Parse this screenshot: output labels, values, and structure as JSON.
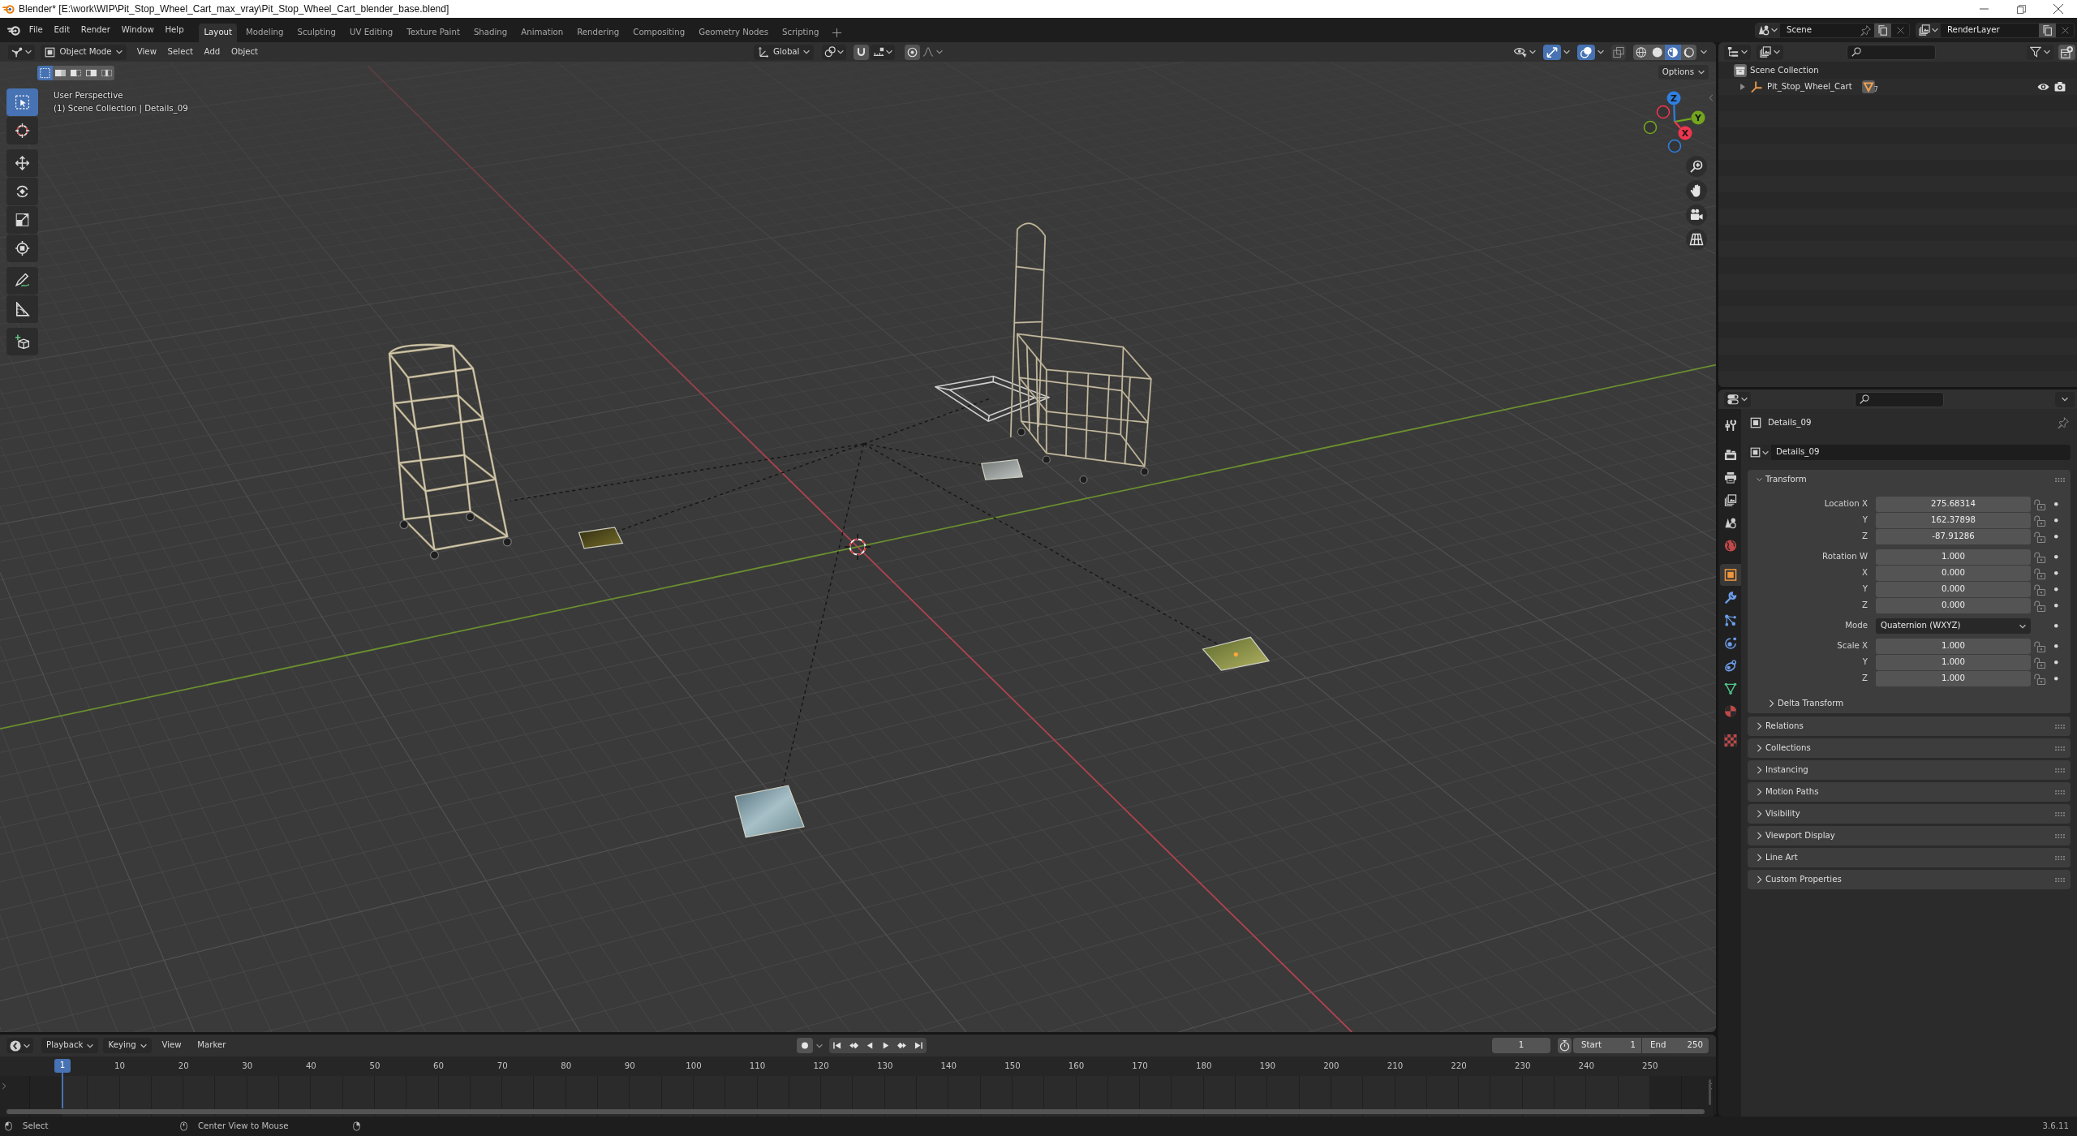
{
  "window": {
    "title": "Blender* [E:\\work\\WIP\\Pit_Stop_Wheel_Cart_max_vray\\Pit_Stop_Wheel_Cart_blender_base.blend]"
  },
  "menu": [
    "File",
    "Edit",
    "Render",
    "Window",
    "Help"
  ],
  "workspaces": [
    {
      "label": "Layout",
      "selected": true
    },
    {
      "label": "Modeling",
      "selected": false
    },
    {
      "label": "Sculpting",
      "selected": false
    },
    {
      "label": "UV Editing",
      "selected": false
    },
    {
      "label": "Texture Paint",
      "selected": false
    },
    {
      "label": "Shading",
      "selected": false
    },
    {
      "label": "Animation",
      "selected": false
    },
    {
      "label": "Rendering",
      "selected": false
    },
    {
      "label": "Compositing",
      "selected": false
    },
    {
      "label": "Geometry Nodes",
      "selected": false
    },
    {
      "label": "Scripting",
      "selected": false
    }
  ],
  "scene": {
    "name": "Scene",
    "view_layer": "RenderLayer"
  },
  "viewport": {
    "mode": "Object Mode",
    "menus": [
      "View",
      "Select",
      "Add",
      "Object"
    ],
    "orientation": "Global",
    "toggles": [
      {
        "kind": "gizmos",
        "on": true
      },
      {
        "kind": "overlays",
        "on": true
      },
      {
        "kind": "xray",
        "on": false
      }
    ],
    "shading": [
      {
        "kind": "wireframe",
        "selected": false
      },
      {
        "kind": "solid",
        "selected": false
      },
      {
        "kind": "material",
        "selected": true
      },
      {
        "kind": "rendered",
        "selected": false
      }
    ],
    "select_modes": [
      {
        "kind": "set",
        "selected": true
      },
      {
        "kind": "extend",
        "selected": false
      },
      {
        "kind": "subtract",
        "selected": false
      },
      {
        "kind": "invert",
        "selected": false
      },
      {
        "kind": "intersect",
        "selected": false
      }
    ],
    "tool_groups": [
      {
        "tools": [
          {
            "kind": "select_box",
            "selected": true
          },
          {
            "kind": "cursor",
            "selected": false
          }
        ]
      },
      {
        "tools": [
          {
            "kind": "move",
            "selected": false
          },
          {
            "kind": "rotate",
            "selected": false
          },
          {
            "kind": "scale",
            "selected": false
          },
          {
            "kind": "transform",
            "selected": false
          }
        ]
      },
      {
        "tools": [
          {
            "kind": "annotate",
            "selected": false
          },
          {
            "kind": "measure",
            "selected": false
          }
        ]
      },
      {
        "tools": [
          {
            "kind": "add_cube",
            "selected": false
          }
        ]
      }
    ],
    "view_name": "User Perspective",
    "context": "(1) Scene Collection | Details_09",
    "options": "Options",
    "axes": [
      {
        "kind": "z",
        "label": "Z",
        "color": "#2f7fe0"
      },
      {
        "kind": "y",
        "label": "Y",
        "color": "#74a51e"
      },
      {
        "kind": "x",
        "label": "X",
        "color": "#f0354f"
      }
    ]
  },
  "outliner": {
    "tree": [
      {
        "kind": "collection",
        "label": "Scene Collection",
        "children": [
          {
            "kind": "empty",
            "label": "Pit_Stop_Wheel_Cart",
            "expanded": false,
            "child_count": "7",
            "visible": true,
            "renderable": true
          }
        ]
      }
    ]
  },
  "properties": {
    "tab_groups": [
      {
        "tabs": [
          {
            "kind": "tool",
            "selected": false
          }
        ]
      },
      {
        "tabs": [
          {
            "kind": "render",
            "selected": false
          },
          {
            "kind": "output",
            "selected": false
          },
          {
            "kind": "view_layer",
            "selected": false
          },
          {
            "kind": "scene",
            "selected": false
          },
          {
            "kind": "world",
            "selected": false
          }
        ]
      },
      {
        "tabs": [
          {
            "kind": "object",
            "selected": true
          },
          {
            "kind": "modifiers",
            "selected": false
          },
          {
            "kind": "particles",
            "selected": false
          },
          {
            "kind": "physics",
            "selected": false
          },
          {
            "kind": "constraints",
            "selected": false
          },
          {
            "kind": "data",
            "selected": false
          },
          {
            "kind": "material",
            "selected": false
          }
        ]
      },
      {
        "tabs": [
          {
            "kind": "texture",
            "selected": false
          }
        ]
      }
    ],
    "object_name": "Details_09",
    "datablock": "Details_09",
    "transform": {
      "title": "Transform",
      "expanded": true,
      "groups": [
        {
          "rows": [
            {
              "kind": "number",
              "label": "Location X",
              "value": "275.68314",
              "locked": false
            },
            {
              "kind": "number",
              "label": "Y",
              "value": "162.37898",
              "locked": false
            },
            {
              "kind": "number",
              "label": "Z",
              "value": "-87.91286",
              "locked": false
            }
          ]
        },
        {
          "rows": [
            {
              "kind": "number",
              "label": "Rotation W",
              "value": "1.000",
              "locked": false
            },
            {
              "kind": "number",
              "label": "X",
              "value": "0.000",
              "locked": false
            },
            {
              "kind": "number",
              "label": "Y",
              "value": "0.000",
              "locked": false
            },
            {
              "kind": "number",
              "label": "Z",
              "value": "0.000",
              "locked": false
            }
          ]
        },
        {
          "rows": [
            {
              "kind": "dropdown",
              "label": "Mode",
              "value": "Quaternion (WXYZ)"
            }
          ]
        },
        {
          "rows": [
            {
              "kind": "number",
              "label": "Scale X",
              "value": "1.000",
              "locked": false
            },
            {
              "kind": "number",
              "label": "Y",
              "value": "1.000",
              "locked": false
            },
            {
              "kind": "number",
              "label": "Z",
              "value": "1.000",
              "locked": false
            }
          ]
        }
      ],
      "subpanels": [
        {
          "title": "Delta Transform",
          "expanded": false
        }
      ]
    },
    "panels": [
      {
        "title": "Relations",
        "expanded": false
      },
      {
        "title": "Collections",
        "expanded": false
      },
      {
        "title": "Instancing",
        "expanded": false
      },
      {
        "title": "Motion Paths",
        "expanded": false
      },
      {
        "title": "Visibility",
        "expanded": false
      },
      {
        "title": "Viewport Display",
        "expanded": false
      },
      {
        "title": "Line Art",
        "expanded": false
      },
      {
        "title": "Custom Properties",
        "expanded": false
      }
    ]
  },
  "timeline": {
    "menus": [
      {
        "kind": "dropdown",
        "label": "Playback"
      },
      {
        "kind": "dropdown",
        "label": "Keying"
      },
      {
        "kind": "menu",
        "label": "View"
      },
      {
        "kind": "menu",
        "label": "Marker"
      }
    ],
    "playhead": "1",
    "ticks": [
      "10",
      "20",
      "30",
      "40",
      "50",
      "60",
      "70",
      "80",
      "90",
      "100",
      "110",
      "120",
      "130",
      "140",
      "150",
      "160",
      "170",
      "180",
      "190",
      "200",
      "210",
      "220",
      "230",
      "240",
      "250"
    ],
    "current_frame": "1",
    "start_label": "Start",
    "start": "1",
    "end_label": "End",
    "end": "250"
  },
  "status_bar": {
    "hints": [
      {
        "kind": "left",
        "label": "Select"
      },
      {
        "kind": "middle",
        "label": "Center View to Mouse"
      },
      {
        "kind": "right"
      }
    ],
    "version": "3.6.11"
  }
}
